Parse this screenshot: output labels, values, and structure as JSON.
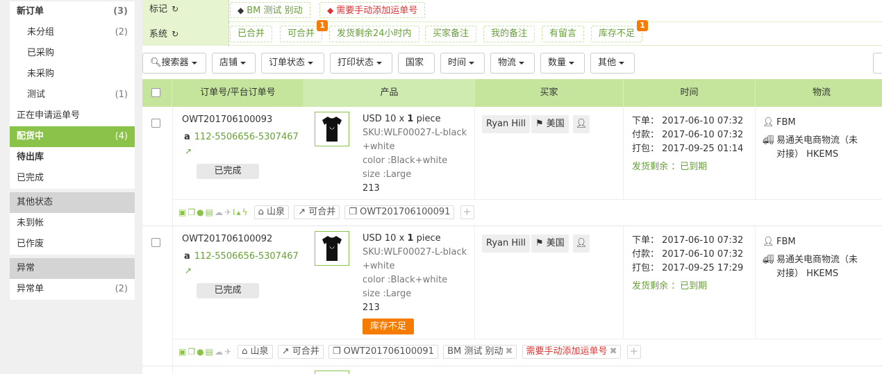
{
  "sidebar": {
    "items": [
      {
        "label": "新订单",
        "count": "(3)"
      },
      {
        "label": "未分组",
        "count": "(2)"
      },
      {
        "label": "已采购",
        "count": ""
      },
      {
        "label": "未采购",
        "count": ""
      },
      {
        "label": "测试",
        "count": "(1)"
      },
      {
        "label": "正在申请运单号",
        "count": ""
      },
      {
        "label": "配货中",
        "count": "(4)"
      },
      {
        "label": "待出库",
        "count": ""
      },
      {
        "label": "已完成",
        "count": ""
      },
      {
        "label": "其他状态",
        "count": ""
      },
      {
        "label": "未到帐",
        "count": ""
      },
      {
        "label": "已作废",
        "count": ""
      },
      {
        "label": "异常",
        "count": ""
      },
      {
        "label": "异常单",
        "count": "(2)"
      }
    ]
  },
  "filters": {
    "mark_label": "标记",
    "mark_chips": [
      "BM 测试 别动",
      "需要手动添加运单号"
    ],
    "system_label": "系统",
    "system_chips": [
      "已合并",
      "可合并",
      "发货剩余24小时内",
      "买家备注",
      "我的备注",
      "有留言",
      "库存不足"
    ],
    "badges": [
      "1",
      "1"
    ]
  },
  "toolbar": {
    "buttons": [
      "搜索器",
      "店铺",
      "订单状态",
      "打印状态",
      "国家",
      "时间",
      "物流",
      "数量",
      "其他"
    ]
  },
  "table": {
    "headers": [
      "订单号/平台订单号",
      "产品",
      "买家",
      "时间",
      "物流"
    ]
  },
  "orders": [
    {
      "order_no": "OWT201706100093",
      "platform_no": "112-5506656-5307467",
      "status": "已完成",
      "price": "USD 10 x ",
      "qty": "1",
      "unit": " piece",
      "sku": "SKU:WLF00027-L-black",
      "sku2": "+white",
      "color": "color :Black+white",
      "size": "size :Large",
      "code": "213",
      "buyer": "Ryan Hill",
      "country": "美国",
      "order_time": "下单： 2017-06-10 07:32",
      "pay_time": "付款： 2017-06-10 07:32",
      "pack_time": "打包： 2017-09-25 01:14",
      "ship_remain": "发货剩余 ：已到期",
      "fulfil": "FBM",
      "logistics": "易通关电商物流（未",
      "logistics2": "对接） HKEMS",
      "tags": [
        "山泉",
        "可合并",
        "OWT201706100091"
      ]
    },
    {
      "order_no": "OWT201706100092",
      "platform_no": "112-5506656-5307467",
      "status": "已完成",
      "price": "USD 10 x ",
      "qty": "1",
      "unit": " piece",
      "sku": "SKU:WLF00027-L-black",
      "sku2": "+white",
      "color": "color :Black+white",
      "size": "size :Large",
      "code": "213",
      "stock": "库存不足",
      "buyer": "Ryan Hill",
      "country": "美国",
      "order_time": "下单： 2017-06-10 07:32",
      "pay_time": "付款： 2017-06-10 07:32",
      "pack_time": "打包： 2017-09-25 17:29",
      "ship_remain": "发货剩余 ：已到期",
      "fulfil": "FBM",
      "logistics": "易通关电商物流（未",
      "logistics2": "对接） HKEMS",
      "tags": [
        "山泉",
        "可合并",
        "OWT201706100091",
        "BM 测试 别动",
        "需要手动添加运单号"
      ]
    }
  ]
}
